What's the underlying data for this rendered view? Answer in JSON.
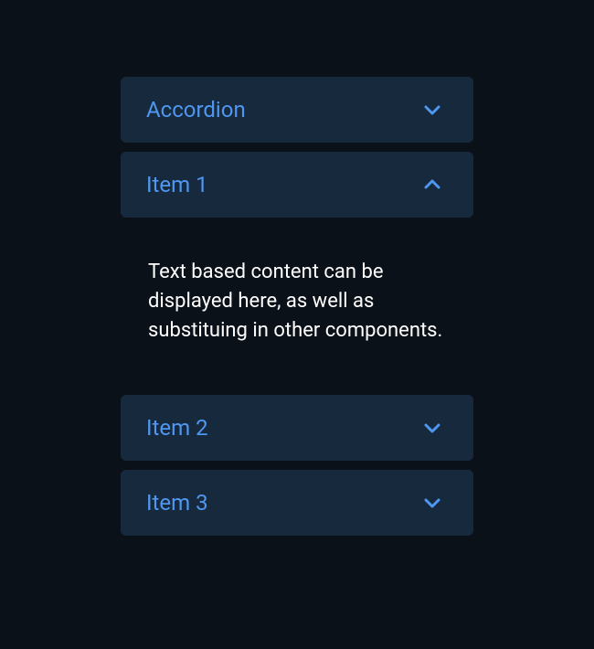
{
  "accordion": {
    "items": [
      {
        "label": "Accordion",
        "expanded": false
      },
      {
        "label": "Item 1",
        "expanded": true,
        "content": "Text based content can be displayed here, as well as substituing in other components."
      },
      {
        "label": "Item 2",
        "expanded": false
      },
      {
        "label": "Item 3",
        "expanded": false
      }
    ]
  }
}
